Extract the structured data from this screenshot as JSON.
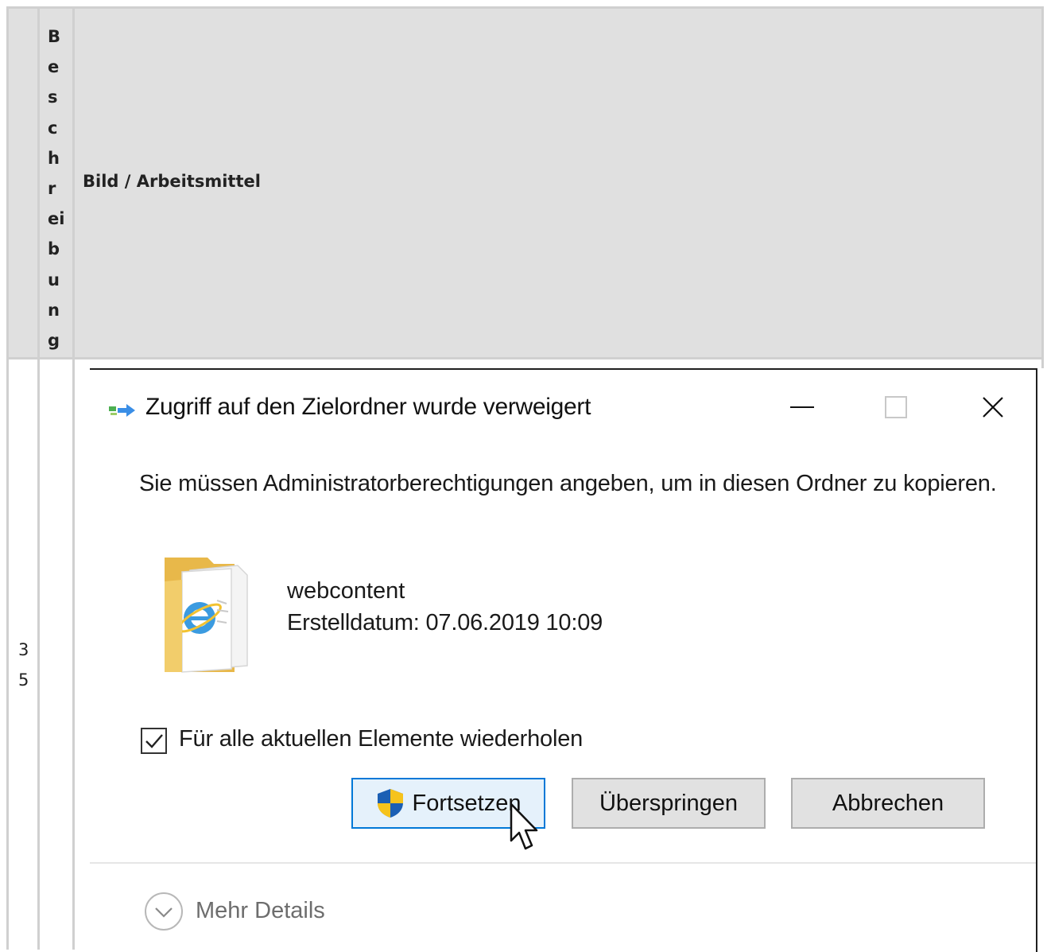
{
  "table": {
    "header": {
      "col2_label": "B\ne\ns\nc\nh\nr\nei\nb\nu\nn\ng",
      "col3_label": "Bild / Arbeitsmittel"
    },
    "row": {
      "number": "3\n5"
    }
  },
  "dialog": {
    "title": "Zugriff auf den Zielordner wurde verweigert",
    "window_controls": [
      "minimize-icon",
      "maximize-icon",
      "close-icon"
    ],
    "message": "Sie müssen Administratorberechtigungen angeben, um in diesen Ordner zu kopieren.",
    "item": {
      "icon": "folder-ie-icon",
      "name": "webcontent",
      "date": "Erstelldatum: 07.06.2019 10:09"
    },
    "checkbox": {
      "label": "Für alle aktuellen Elemente wiederholen",
      "checked": true
    },
    "buttons": {
      "continue": "Fortsetzen",
      "skip": "Überspringen",
      "cancel": "Abbrechen"
    },
    "more_details": "Mehr Details"
  },
  "colors": {
    "table_border": "#d0d0d0",
    "header_bg": "#e0e0e0",
    "focus_border": "#0078d7",
    "focus_bg": "#e5f1fb"
  }
}
